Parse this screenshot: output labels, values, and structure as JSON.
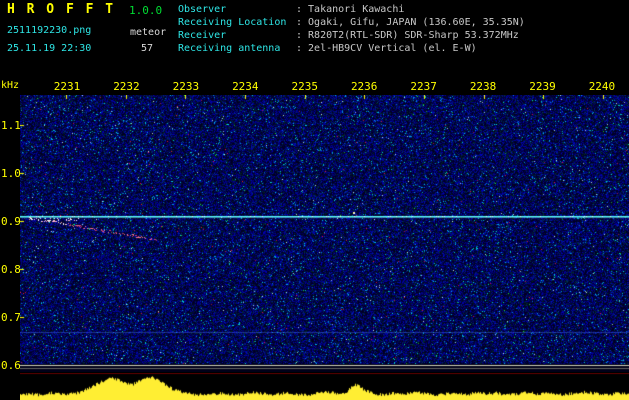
{
  "header": {
    "app_name": "H R O F F T",
    "version": "1.0.0",
    "filename": "2511192230.png",
    "mode": "meteor",
    "datetime": "25.11.19 22:30",
    "count": "57",
    "separator": ":",
    "info": [
      {
        "label": "Observer",
        "value": "Takanori Kawachi"
      },
      {
        "label": "Receiving Location",
        "value": "Ogaki, Gifu, JAPAN (136.60E, 35.35N)"
      },
      {
        "label": "Receiver",
        "value": "R820T2(RTL-SDR) SDR-Sharp 53.372MHz"
      },
      {
        "label": "Receiving antenna",
        "value": "2el-HB9CV Vertical (el. E-W)"
      }
    ]
  },
  "chart_data": {
    "type": "heatmap",
    "title": "HROFFT meteor echo spectrogram",
    "x_tick_labels": [
      "2231",
      "2232",
      "2233",
      "2234",
      "2235",
      "2236",
      "2237",
      "2238",
      "2239",
      "2240"
    ],
    "y_axis_unit": "kHz",
    "y_tick_labels": [
      "1.1",
      "1.0",
      "0.9",
      "0.8",
      "0.7",
      "0.6"
    ],
    "y_range_khz": [
      0.6,
      1.15
    ],
    "carrier_line_khz": 0.91,
    "meteor_echo": {
      "from": {
        "x_frac": 0.016,
        "khz": 0.908
      },
      "to": {
        "x_frac": 0.225,
        "khz": 0.862
      }
    },
    "spot": {
      "x_frac": 0.55,
      "khz": 0.915
    },
    "signal_strength_bars": [
      5,
      6,
      5,
      7,
      6,
      6,
      8,
      13,
      18,
      22,
      19,
      15,
      21,
      23,
      17,
      11,
      8,
      6,
      5,
      6,
      7,
      5,
      6,
      8,
      6,
      5,
      7,
      6,
      5,
      6,
      8,
      7,
      6,
      16,
      10,
      6,
      5,
      7,
      6,
      8,
      6,
      5,
      6,
      7,
      5,
      8,
      6,
      7,
      5,
      6,
      8,
      6,
      7,
      5,
      6,
      7,
      8,
      6,
      5,
      7,
      6
    ]
  },
  "colors": {
    "noise_background": "#000066",
    "carrier_line": "#55ffff",
    "meteor_trace": "#cc4477",
    "histogram": "#ffee33",
    "axis_text": "#ffff00",
    "label_cyan": "#2ee6e6",
    "value_white": "#c8c8c8",
    "version_green": "#00dd33"
  }
}
